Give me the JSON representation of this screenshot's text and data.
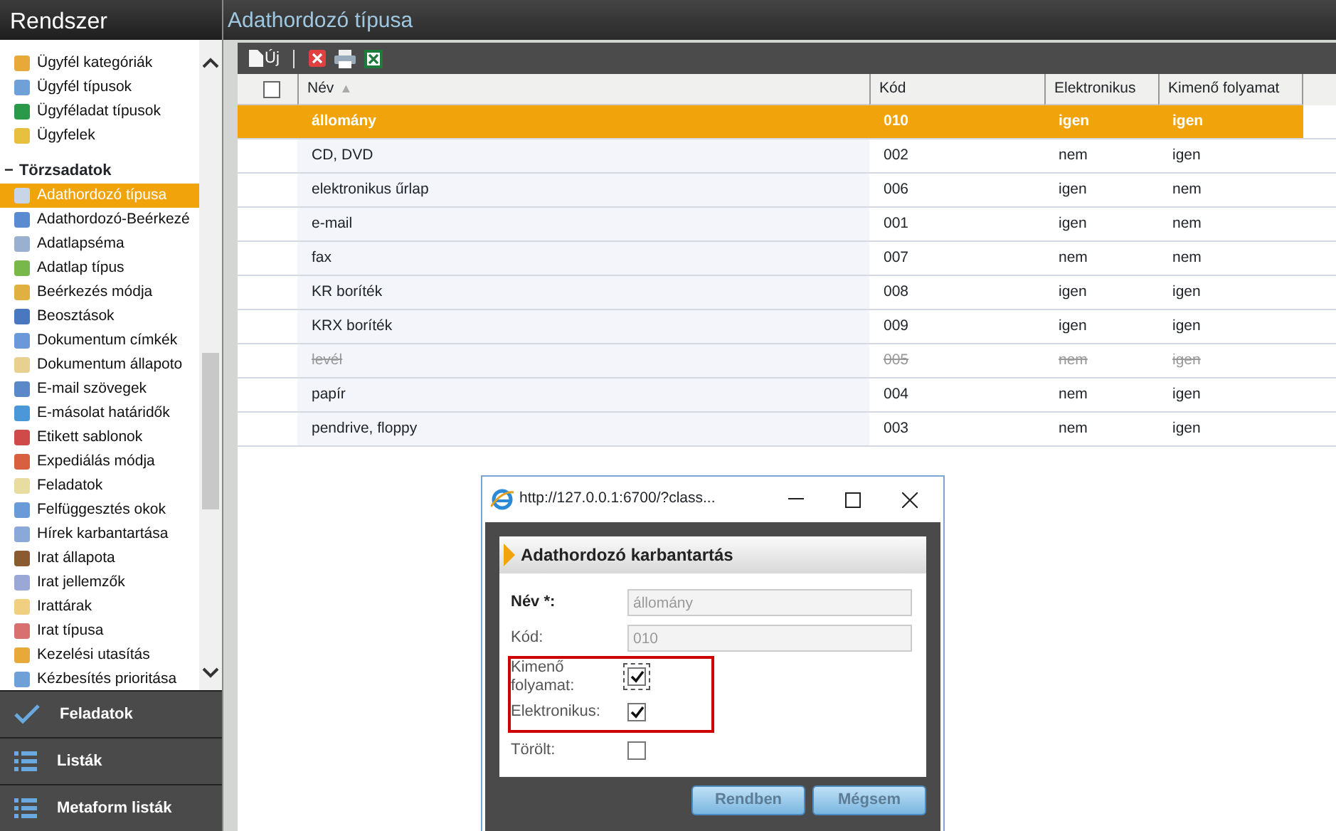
{
  "sidebar": {
    "title": "Rendszer",
    "items": [
      {
        "label": "Ügyfél kategóriák",
        "selected": false
      },
      {
        "label": "Ügyfél típusok",
        "selected": false
      },
      {
        "label": "Ügyféladat típusok",
        "selected": false
      },
      {
        "label": "Ügyfelek",
        "selected": false
      }
    ],
    "group": {
      "label": "Törzsadatok",
      "toggle": "−",
      "items": [
        {
          "label": "Adathordozó típusa",
          "selected": true
        },
        {
          "label": "Adathordozó-Beérkezé",
          "selected": false
        },
        {
          "label": "Adatlapséma",
          "selected": false
        },
        {
          "label": "Adatlap típus",
          "selected": false
        },
        {
          "label": "Beérkezés módja",
          "selected": false
        },
        {
          "label": "Beosztások",
          "selected": false
        },
        {
          "label": "Dokumentum címkék",
          "selected": false
        },
        {
          "label": "Dokumentum állapoto",
          "selected": false
        },
        {
          "label": "E-mail szövegek",
          "selected": false
        },
        {
          "label": "E-másolat határidők",
          "selected": false
        },
        {
          "label": "Etikett sablonok",
          "selected": false
        },
        {
          "label": "Expediálás módja",
          "selected": false
        },
        {
          "label": "Feladatok",
          "selected": false
        },
        {
          "label": "Felfüggesztés okok",
          "selected": false
        },
        {
          "label": "Hírek karbantartása",
          "selected": false
        },
        {
          "label": "Irat állapota",
          "selected": false
        },
        {
          "label": "Irat jellemzők",
          "selected": false
        },
        {
          "label": "Irattárak",
          "selected": false
        },
        {
          "label": "Irat típusa",
          "selected": false
        },
        {
          "label": "Kezelési utasítás",
          "selected": false
        },
        {
          "label": "Kézbesítés prioritása",
          "selected": false
        }
      ]
    },
    "nav": [
      {
        "label": "Feladatok",
        "kind": "check"
      },
      {
        "label": "Listák",
        "kind": "list"
      },
      {
        "label": "Metaform listák",
        "kind": "list"
      }
    ]
  },
  "page": {
    "title": "Adathordozó típusa"
  },
  "toolbar": {
    "new_label": "Új"
  },
  "table": {
    "columns": [
      {
        "label": "Név",
        "sort": "▲"
      },
      {
        "label": "Kód"
      },
      {
        "label": "Elektronikus"
      },
      {
        "label": "Kimenő folyamat"
      }
    ],
    "select_all": false,
    "rows": [
      {
        "cells": [
          "állomány",
          "010",
          "igen",
          "igen"
        ],
        "selected": true,
        "deleted": false
      },
      {
        "cells": [
          "CD, DVD",
          "002",
          "nem",
          "igen"
        ],
        "selected": false,
        "deleted": false
      },
      {
        "cells": [
          "elektronikus űrlap",
          "006",
          "igen",
          "nem"
        ],
        "selected": false,
        "deleted": false
      },
      {
        "cells": [
          "e-mail",
          "001",
          "igen",
          "nem"
        ],
        "selected": false,
        "deleted": false
      },
      {
        "cells": [
          "fax",
          "007",
          "nem",
          "nem"
        ],
        "selected": false,
        "deleted": false
      },
      {
        "cells": [
          "KR boríték",
          "008",
          "igen",
          "igen"
        ],
        "selected": false,
        "deleted": false
      },
      {
        "cells": [
          "KRX boríték",
          "009",
          "igen",
          "igen"
        ],
        "selected": false,
        "deleted": false
      },
      {
        "cells": [
          "levél",
          "005",
          "nem",
          "igen"
        ],
        "selected": false,
        "deleted": true
      },
      {
        "cells": [
          "papír",
          "004",
          "nem",
          "igen"
        ],
        "selected": false,
        "deleted": false
      },
      {
        "cells": [
          "pendrive, floppy",
          "003",
          "nem",
          "igen"
        ],
        "selected": false,
        "deleted": false
      }
    ]
  },
  "dialog": {
    "window_title": "http://127.0.0.1:6700/?class...",
    "title": "Adathordozó karbantartás",
    "fields": [
      {
        "kind": "text",
        "label": "Név *:",
        "required": true,
        "value": "állomány",
        "disabled": true
      },
      {
        "kind": "text",
        "label": "Kód:",
        "required": false,
        "value": "010",
        "disabled": true
      },
      {
        "kind": "checkbox",
        "label": "Kimenő folyamat:",
        "checked": true,
        "focused": true,
        "highlighted": true
      },
      {
        "kind": "checkbox",
        "label": "Elektronikus:",
        "checked": true,
        "highlighted": true
      },
      {
        "kind": "checkbox",
        "label": "Törölt:",
        "checked": false,
        "highlighted": false
      }
    ],
    "buttons": [
      "Rendben",
      "Mégsem"
    ]
  }
}
